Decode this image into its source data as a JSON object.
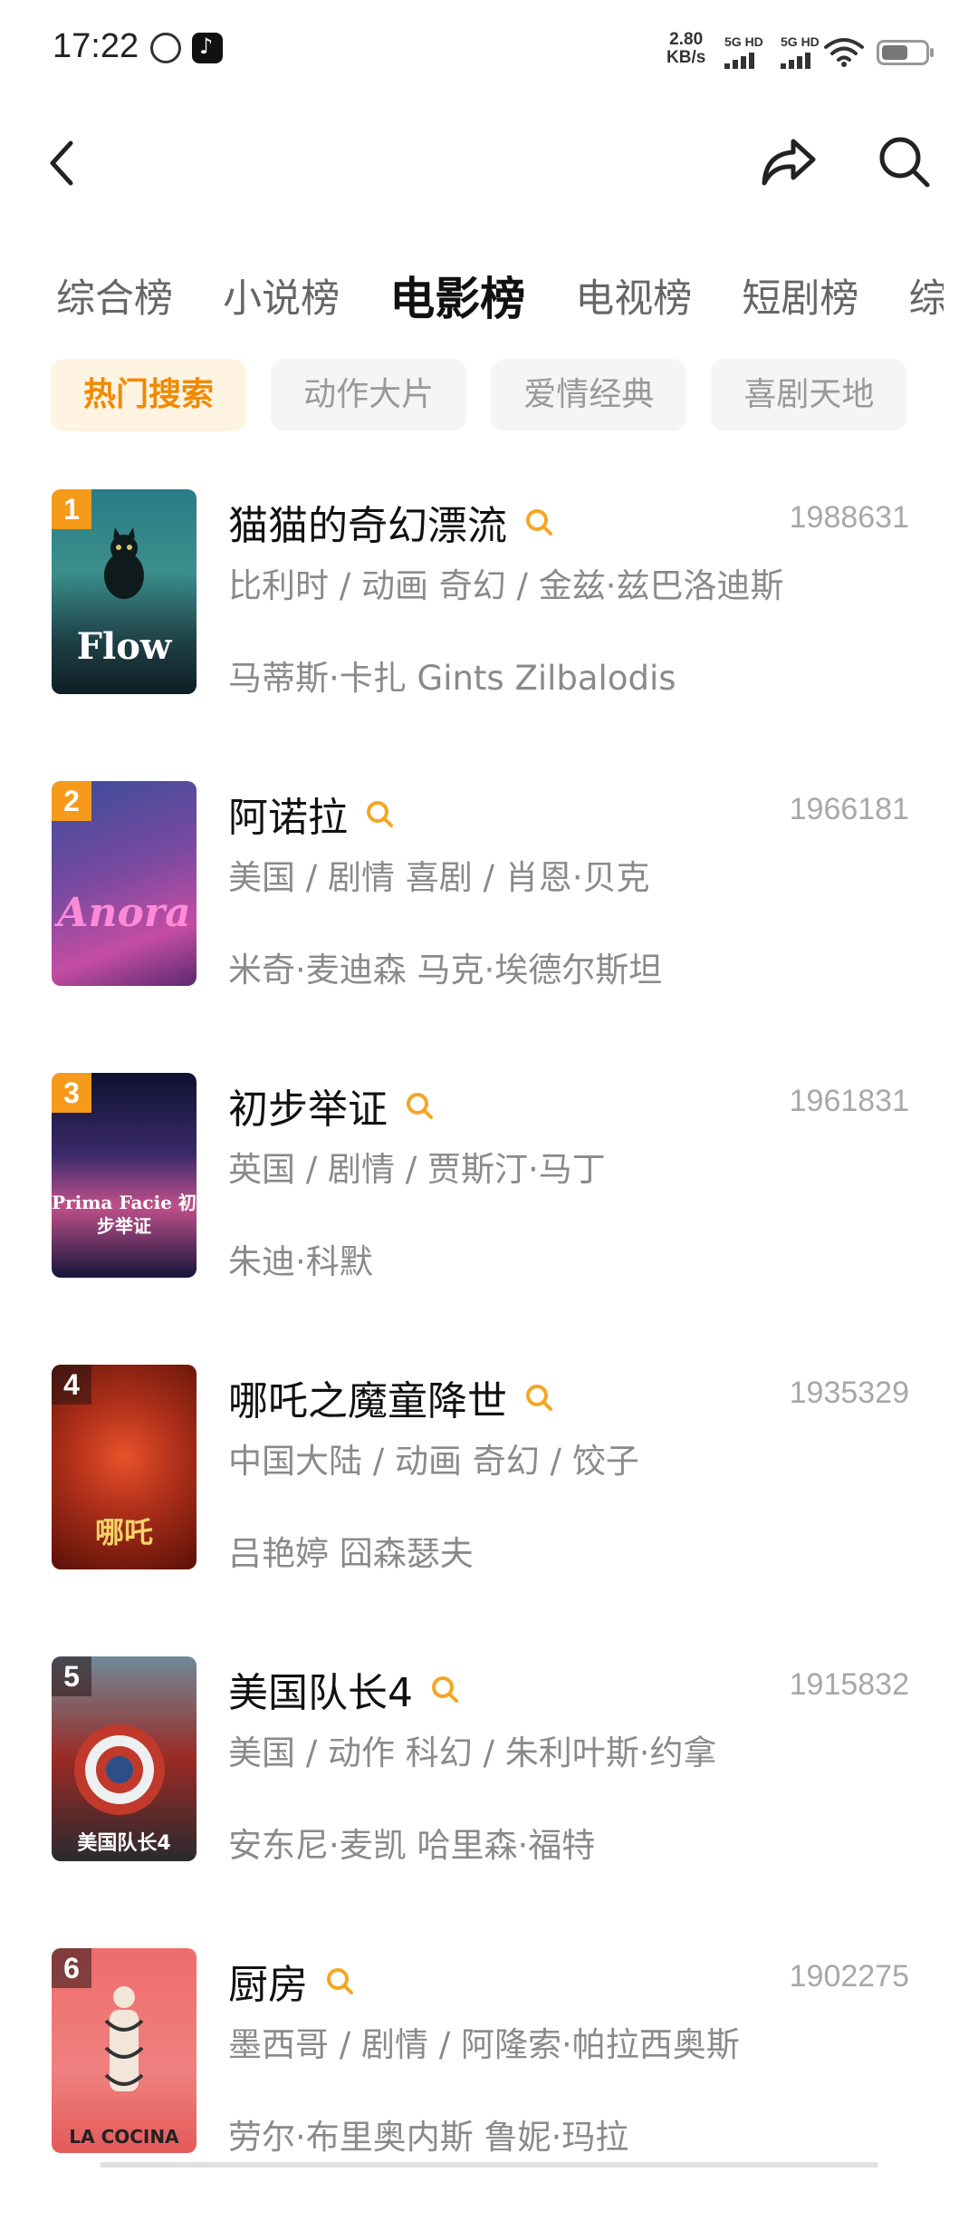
{
  "status_bar": {
    "time": "17:22",
    "net_speed_value": "2.80",
    "net_speed_unit": "KB/s",
    "signal_1_label": "5G HD",
    "signal_2_label": "5G HD"
  },
  "toolbar": {
    "back_icon": "chevron-left-icon",
    "share_icon": "share-arrow-icon",
    "search_icon": "search-icon"
  },
  "tabs": [
    {
      "label": "综合榜",
      "active": false
    },
    {
      "label": "小说榜",
      "active": false
    },
    {
      "label": "电影榜",
      "active": true
    },
    {
      "label": "电视榜",
      "active": false
    },
    {
      "label": "短剧榜",
      "active": false
    },
    {
      "label": "综",
      "active": false
    }
  ],
  "chips": [
    {
      "label": "热门搜索",
      "active": true
    },
    {
      "label": "动作大片",
      "active": false
    },
    {
      "label": "爱情经典",
      "active": false
    },
    {
      "label": "喜剧天地",
      "active": false
    }
  ],
  "colors": {
    "accent": "#f59a1a",
    "chip_active_bg": "#fff3e2",
    "chip_active_text": "#f08a00"
  },
  "movies": [
    {
      "rank": "1",
      "title": "猫猫的奇幻漂流",
      "score": "1988631",
      "meta": "比利时 / 动画 奇幻 / 金兹·兹巴洛迪斯",
      "cast": "马蒂斯·卡扎 Gints Zilbalodis",
      "poster_text": "Flow"
    },
    {
      "rank": "2",
      "title": "阿诺拉",
      "score": "1966181",
      "meta": "美国 / 剧情 喜剧 / 肖恩·贝克",
      "cast": "米奇·麦迪森 马克·埃德尔斯坦",
      "poster_text": "Anora"
    },
    {
      "rank": "3",
      "title": "初步举证",
      "score": "1961831",
      "meta": "英国 / 剧情 / 贾斯汀·马丁",
      "cast": "朱迪·科默",
      "poster_text": "Prima Facie 初步举证"
    },
    {
      "rank": "4",
      "title": "哪吒之魔童降世",
      "score": "1935329",
      "meta": "中国大陆 / 动画 奇幻 / 饺子",
      "cast": "吕艳婷 囧森瑟夫",
      "poster_text": "哪吒"
    },
    {
      "rank": "5",
      "title": "美国队长4",
      "score": "1915832",
      "meta": "美国 / 动作 科幻 / 朱利叶斯·约拿",
      "cast": "安东尼·麦凯 哈里森·福特",
      "poster_text": "美国队长4"
    },
    {
      "rank": "6",
      "title": "厨房",
      "score": "1902275",
      "meta": "墨西哥 / 剧情 / 阿隆索·帕拉西奥斯",
      "cast": "劳尔·布里奥内斯 鲁妮·玛拉",
      "poster_text": "LA COCINA"
    }
  ]
}
